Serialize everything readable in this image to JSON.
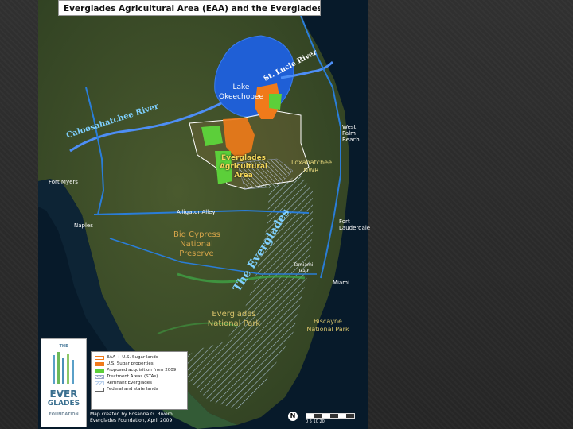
{
  "map": {
    "title": "Everglades Agricultural Area (EAA) and the Everglades region",
    "lake": [
      "Lake",
      "Okeechobee"
    ],
    "river_left": "Caloosahatchee River",
    "river_right": "St. Lucie River",
    "eaa": [
      "Everglades",
      "Agricultural",
      "Area"
    ],
    "everglades_curve": "The Everglades",
    "cities": {
      "west_palm": [
        "West",
        "Palm",
        "Beach"
      ],
      "fort_myers": "Fort Myers",
      "naples": "Naples",
      "fort_lauderdale": [
        "Fort",
        "Lauderdale"
      ],
      "miami": "Miami"
    },
    "places": {
      "loxahatchee": [
        "Loxahatchee",
        "NWR"
      ],
      "alligator_alley": "Alligator Alley",
      "big_cypress": [
        "Big Cypress",
        "National",
        "Preserve"
      ],
      "tamiami": [
        "Tamiami",
        "Trail"
      ],
      "everglades_np": [
        "Everglades",
        "National Park"
      ],
      "biscayne": [
        "Biscayne",
        "National Park"
      ]
    },
    "legend": {
      "items": [
        {
          "label": "EAA + U.S. Sugar lands",
          "color": "#ffffff",
          "style": "outline-orange"
        },
        {
          "label": "U.S. Sugar properties",
          "color": "#f07a1a",
          "style": "fill"
        },
        {
          "label": "Proposed acquisition from 2009",
          "color": "#5ccf3a",
          "style": "fill"
        },
        {
          "label": "Treatment Areas (STAs)",
          "color": "#9aa6c8",
          "style": "hatch"
        },
        {
          "label": "Remnant Everglades",
          "color": "#b9d0ec",
          "style": "hatch-light"
        },
        {
          "label": "Federal and state lands",
          "color": "#ffffff",
          "style": "outline"
        }
      ]
    },
    "logo": {
      "top": "THE",
      "line1": "EVER",
      "line2": "GLADES",
      "line3": "FOUNDATION"
    },
    "credit": [
      "Map created by Rosanna G. Rivero",
      "Everglades Foundation, April 2009"
    ],
    "north": "N",
    "scale_labels": "0    5    10         20"
  }
}
